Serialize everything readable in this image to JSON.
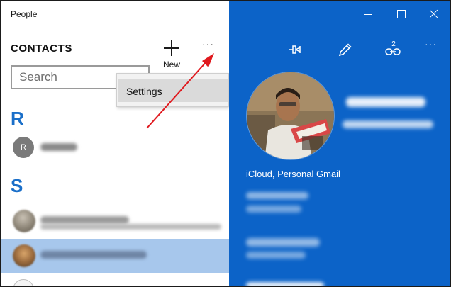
{
  "app": {
    "title": "People"
  },
  "left": {
    "heading": "CONTACTS",
    "new_label": "New",
    "more_glyph": "···",
    "search": {
      "placeholder": "Search",
      "value": ""
    },
    "menu": {
      "settings_label": "Settings"
    },
    "sections": [
      {
        "letter": "R",
        "contacts": [
          {
            "initial": "R",
            "avatar": "initial",
            "selected": false
          }
        ]
      },
      {
        "letter": "S",
        "contacts": [
          {
            "avatar": "photo",
            "selected": false
          },
          {
            "avatar": "photo",
            "selected": true
          }
        ]
      }
    ]
  },
  "right": {
    "toolbar": {
      "icons": [
        "minimize-icon",
        "maximize-icon",
        "close-icon",
        "pin-icon",
        "edit-icon",
        "link-icon",
        "more-icon"
      ],
      "link_count": "2",
      "more_glyph": "···"
    },
    "accounts": "iCloud, Personal Gmail"
  },
  "colors": {
    "accent_blue": "#0c63c8",
    "letter_blue": "#1a6fc9",
    "selected_row": "#a7c7ec",
    "annotation_red": "#e0191e"
  }
}
